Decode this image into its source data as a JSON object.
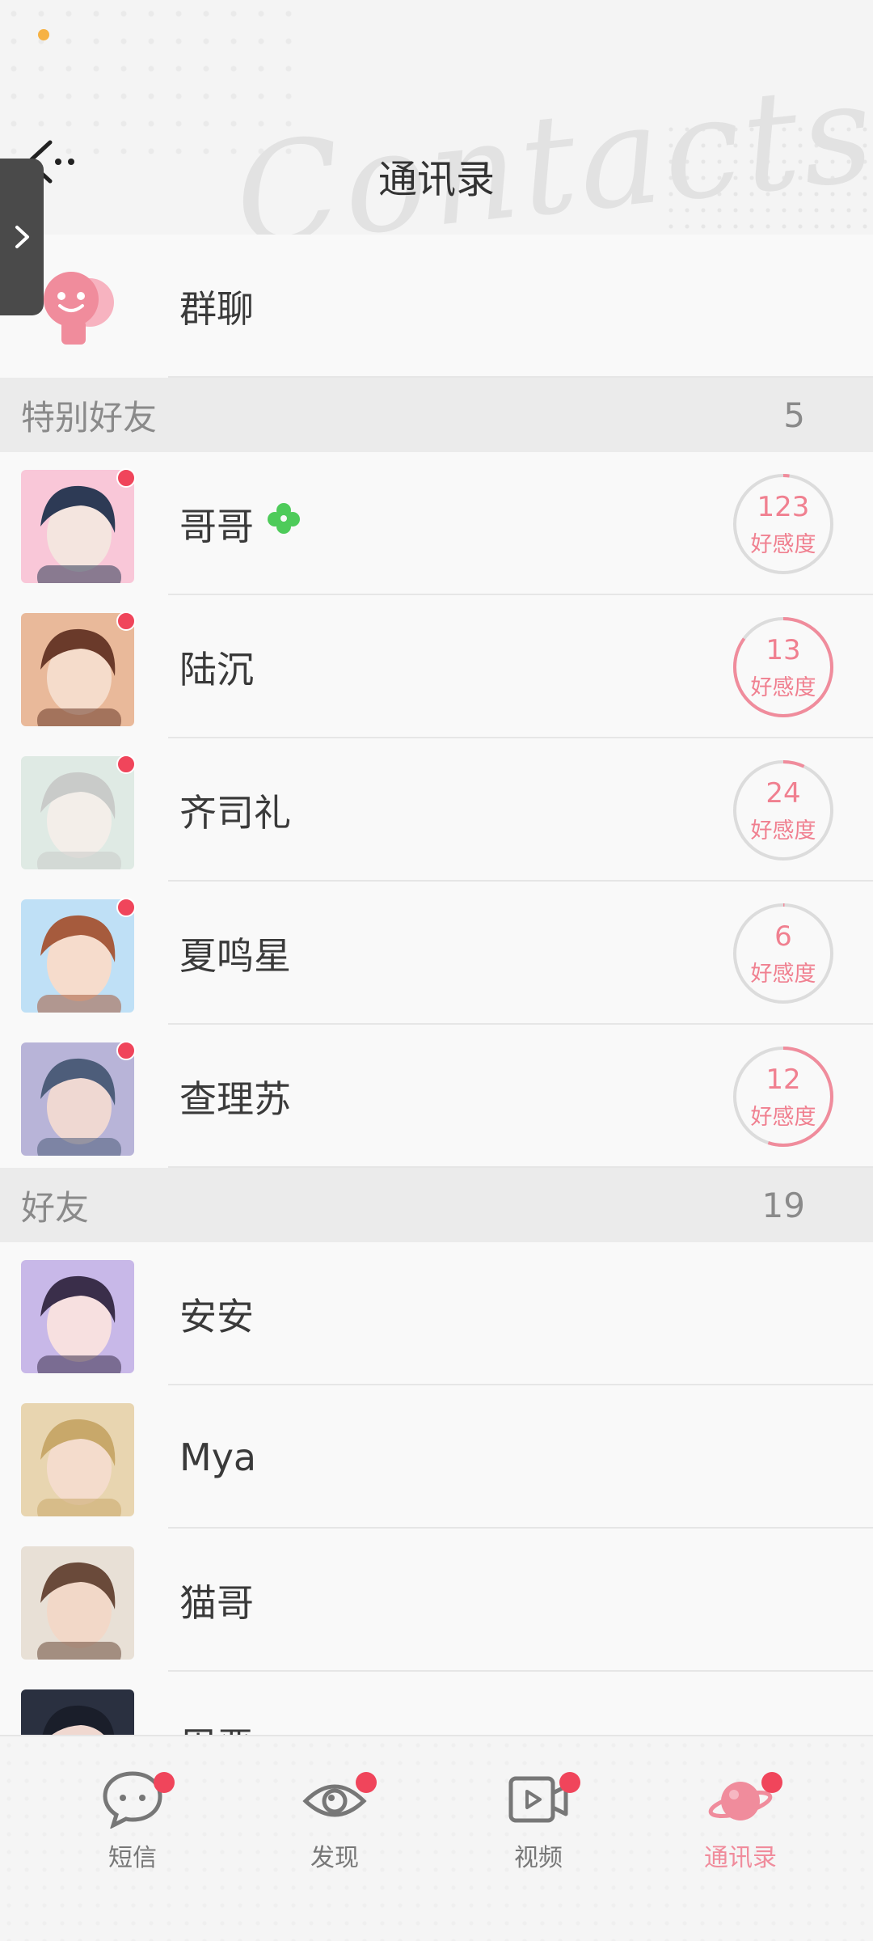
{
  "header": {
    "title": "通讯录",
    "watermark": "Contacts"
  },
  "group_chat": {
    "label": "群聊"
  },
  "special_section": {
    "label": "特别好友",
    "count": "5"
  },
  "special_friends": [
    {
      "name": "哥哥",
      "affinity": "123",
      "affinity_label": "好感度",
      "progress": 0.02,
      "has_clover": true,
      "avatar_colors": [
        "#f9c7d8",
        "#2d3a55",
        "#f4e5df"
      ]
    },
    {
      "name": "陆沉",
      "affinity": "13",
      "affinity_label": "好感度",
      "progress": 0.85,
      "has_clover": false,
      "avatar_colors": [
        "#e9b99a",
        "#6a3a2a",
        "#f5dccb"
      ]
    },
    {
      "name": "齐司礼",
      "affinity": "24",
      "affinity_label": "好感度",
      "progress": 0.07,
      "has_clover": false,
      "avatar_colors": [
        "#dfeae4",
        "#c9cbc9",
        "#f3eee9"
      ]
    },
    {
      "name": "夏鸣星",
      "affinity": "6",
      "affinity_label": "好感度",
      "progress": 0.0,
      "has_clover": false,
      "avatar_colors": [
        "#bfe0f6",
        "#a65b3d",
        "#f6dccc"
      ]
    },
    {
      "name": "查理苏",
      "affinity": "12",
      "affinity_label": "好感度",
      "progress": 0.55,
      "has_clover": false,
      "avatar_colors": [
        "#b8b4d8",
        "#4d5d7a",
        "#efd8d2"
      ]
    }
  ],
  "friends_section": {
    "label": "好友",
    "count": "19"
  },
  "friends": [
    {
      "name": "安安",
      "avatar_colors": [
        "#c8b8e8",
        "#3a2e4a",
        "#f7e0e0"
      ]
    },
    {
      "name": "Mya",
      "avatar_colors": [
        "#e8d5b0",
        "#c8a86a",
        "#f4dccc"
      ]
    },
    {
      "name": "猫哥",
      "avatar_colors": [
        "#e8e0d6",
        "#6a4a3a",
        "#f2d8c8"
      ]
    },
    {
      "name": "周恶",
      "avatar_colors": [
        "#2a3040",
        "#1a1e2a",
        "#f0d8d0"
      ]
    }
  ],
  "nav": [
    {
      "label": "短信",
      "icon": "chat-bubble-icon",
      "active": false
    },
    {
      "label": "发现",
      "icon": "eye-icon",
      "active": false
    },
    {
      "label": "视频",
      "icon": "video-icon",
      "active": false
    },
    {
      "label": "通讯录",
      "icon": "planet-icon",
      "active": true
    }
  ],
  "colors": {
    "accent": "#f08c9c",
    "badge": "#f0455b",
    "status": "#f6b244"
  }
}
